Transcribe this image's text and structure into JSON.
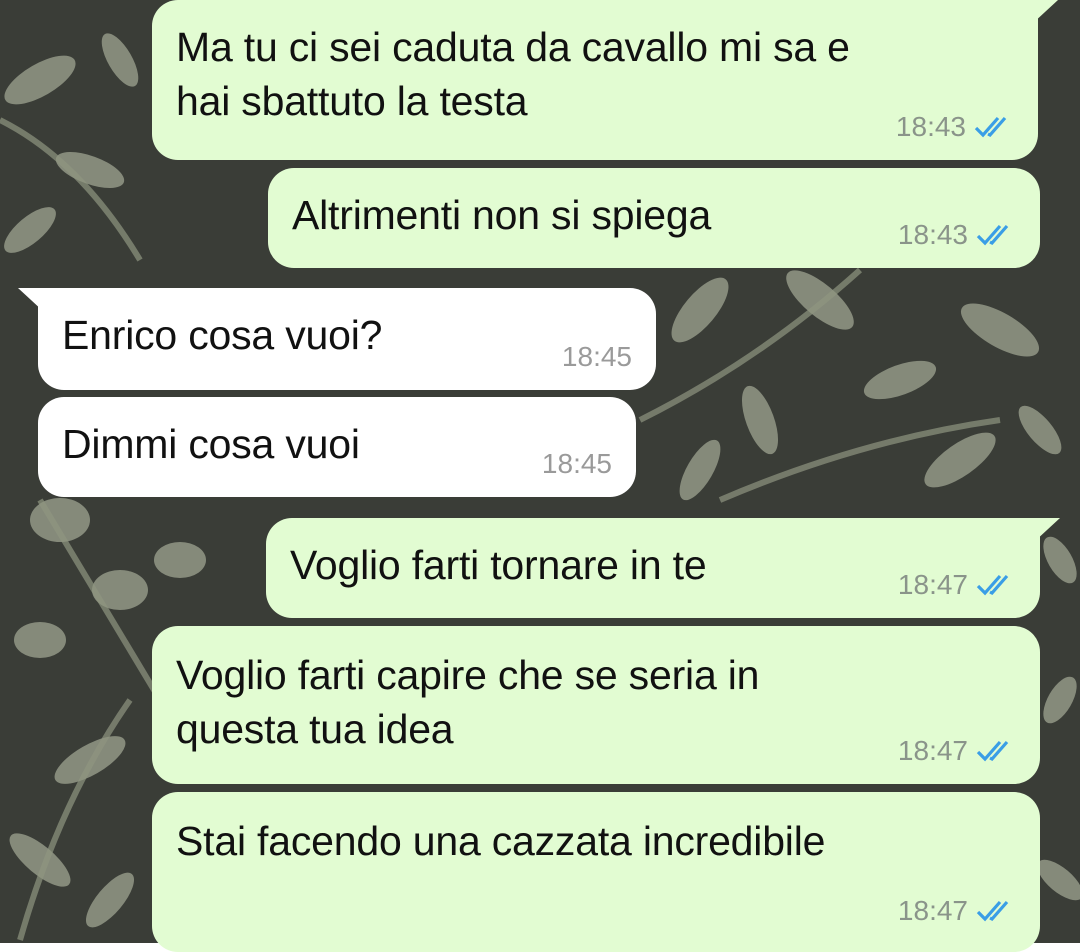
{
  "colors": {
    "outgoing_bubble": "#e2fcd2",
    "incoming_bubble": "#ffffff",
    "read_ticks": "#3a9ee6",
    "wallpaper": "#3a3d37"
  },
  "messages": [
    {
      "direction": "out",
      "text": "Ma tu ci sei caduta da cavallo mi sa e\nhai sbattuto la testa",
      "time": "18:43",
      "status": "read"
    },
    {
      "direction": "out",
      "text": "Altrimenti non si spiega",
      "time": "18:43",
      "status": "read"
    },
    {
      "direction": "in",
      "text": "Enrico cosa vuoi?",
      "time": "18:45"
    },
    {
      "direction": "in",
      "text": "Dimmi cosa vuoi",
      "time": "18:45"
    },
    {
      "direction": "out",
      "text": "Voglio farti tornare in te",
      "time": "18:47",
      "status": "read"
    },
    {
      "direction": "out",
      "text": "Voglio farti capire che se seria in\nquesta tua idea",
      "time": "18:47",
      "status": "read"
    },
    {
      "direction": "out",
      "text": "Stai facendo una cazzata incredibile",
      "time": "18:47",
      "status": "read"
    }
  ]
}
